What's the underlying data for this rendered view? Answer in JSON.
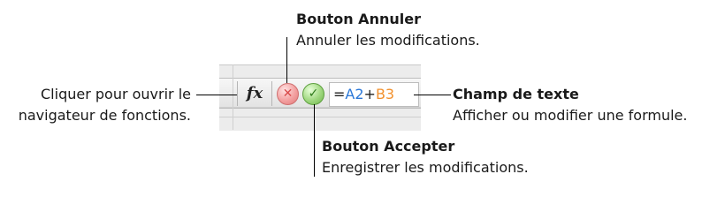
{
  "callouts": {
    "cancel": {
      "title": "Bouton Annuler",
      "desc": "Annuler les modifications."
    },
    "functions": {
      "line1": "Cliquer pour ouvrir le",
      "line2": "navigateur de fonctions."
    },
    "text_field": {
      "title": "Champ de texte",
      "desc": "Afficher ou modifier une formule."
    },
    "accept": {
      "title": "Bouton Accepter",
      "desc": "Enregistrer les modifications."
    }
  },
  "formula_bar": {
    "fx_label": "fx",
    "cancel_glyph": "✕",
    "accept_glyph": "✓",
    "formula": {
      "prefix": "=",
      "ref1": "A2",
      "op": "+",
      "ref2": "B3"
    }
  },
  "colors": {
    "ref1": "#2b78d8",
    "ref2": "#f2912e",
    "cancel": "#e07878",
    "accept": "#6fb64c"
  }
}
